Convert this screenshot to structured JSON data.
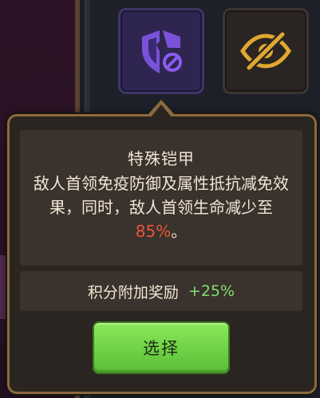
{
  "tiles": [
    {
      "name": "special-armor",
      "icon": "broken-shield-block-icon",
      "selected": true,
      "accent": "#8a5cf0"
    },
    {
      "name": "hidden",
      "icon": "crossed-eye-icon",
      "selected": false,
      "accent": "#e0a830"
    }
  ],
  "tooltip": {
    "title": "特殊铠甲",
    "desc_before": "敌人首领免疫防御及属性抵抗减免效果，同时，敌人首领生命减少至",
    "desc_percent": "85%",
    "desc_after": "。",
    "bonus_label": "积分附加奖励",
    "bonus_value": "+25%",
    "select_label": "选择"
  },
  "colors": {
    "percent_red": "#e8553a",
    "bonus_green": "#7fe070",
    "button_green": "#6fd146",
    "panel_border": "#8a6a3e"
  }
}
